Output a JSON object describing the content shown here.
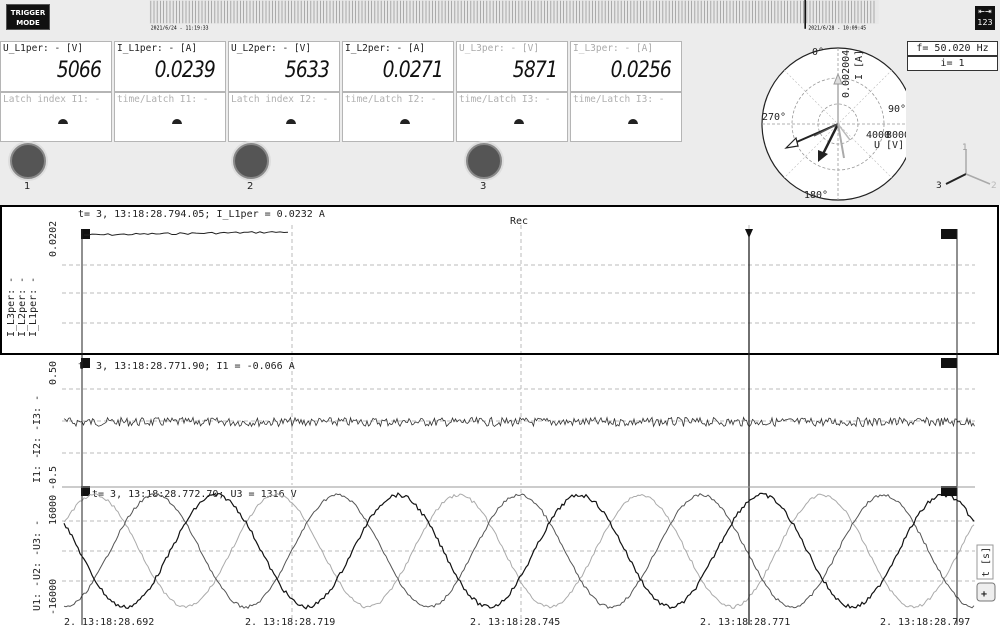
{
  "topbar": {
    "trigger_line1": "TRIGGER",
    "trigger_line2": "MODE",
    "start_date": "2021/6/24 - 11:19:33",
    "end_date": "2021/6/28 - 10:09:45",
    "nav_label": "123"
  },
  "measures": [
    {
      "header": "U_L1per: - [V]",
      "value": "5066",
      "dim": false
    },
    {
      "header": "I_L1per: - [A]",
      "value": "0.0239",
      "dim": false
    },
    {
      "header": "U_L2per: - [V]",
      "value": "5633",
      "dim": false
    },
    {
      "header": "I_L2per: - [A]",
      "value": "0.0271",
      "dim": false
    },
    {
      "header": "U_L3per: - [V]",
      "value": "5871",
      "dim": true
    },
    {
      "header": "I_L3per: - [A]",
      "value": "0.0256",
      "dim": true
    }
  ],
  "latches": [
    {
      "header": "Latch index I1: -"
    },
    {
      "header": "time/Latch I1: -"
    },
    {
      "header": "Latch index I2: -"
    },
    {
      "header": "time/Latch I2: -"
    },
    {
      "header": "time/Latch I3: -"
    },
    {
      "header": "time/Latch I3: -"
    }
  ],
  "leds": [
    "1",
    "2",
    "3"
  ],
  "phasor": {
    "angle_0": "0°",
    "angle_90": "90°",
    "angle_180": "180°",
    "angle_270": "270°",
    "current_scale": "0.002004",
    "current_unit": "I [A]",
    "voltage_scale": "4000",
    "voltage_scale2": "8000",
    "voltage_unit": "U [V]"
  },
  "frequency": "f= 50.020 Hz",
  "index": "i= 1",
  "axes_icon": {
    "x": "3",
    "y": "1",
    "z": "2"
  },
  "colors": {
    "bg_panel": "#ececec",
    "highlight_border": "#000000",
    "phase1": "#1a1a1a",
    "phase2": "#555555",
    "phase3": "#aaaaaa"
  },
  "panel1": {
    "cursor_text": "t= 3, 13:18:28.794.05; I_L1per = 0.0232 A",
    "rec_label": "Rec",
    "ytick_top": "0.0202",
    "ytick_mid": "0.0202",
    "legend": [
      "I_L3per: -",
      "I_L2per: -",
      "I_L1per: -"
    ],
    "marker_left": "T",
    "marker_right": "I3"
  },
  "panel2": {
    "cursor_text": "t= 3, 13:18:28.771.90; I1 = -0.066 A",
    "ytick_top": "0.50",
    "ytick_bottom": "-0.5",
    "legend": [
      "I3: -",
      "I2: -",
      "I1: -"
    ],
    "marker_left": "T",
    "marker_right": "I1"
  },
  "panel3": {
    "cursor_text": "t= 3, 13:18:28.772.70; U3 = 1316 V",
    "ytick_top": "16000",
    "ytick_bottom": "-16000",
    "legend": [
      "U3: -",
      "U2: -",
      "U1: -"
    ],
    "marker_left": "T",
    "marker_right": "I1",
    "t_axis": "t [s]"
  },
  "x_ticks": [
    "2, 13:18:28.692",
    "2, 13:18:28.719",
    "2, 13:18:28.745",
    "2, 13:18:28.771",
    "2, 13:18:28.797"
  ],
  "zoom_label": "+"
}
